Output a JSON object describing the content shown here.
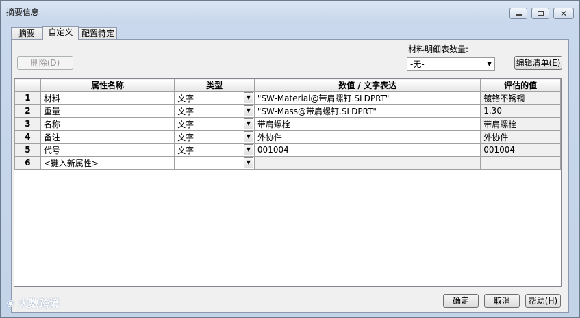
{
  "window": {
    "title": "摘要信息"
  },
  "tabs": [
    {
      "label": "摘要"
    },
    {
      "label": "自定义"
    },
    {
      "label": "配置特定"
    }
  ],
  "toolbar": {
    "delete_label": "删除(D)",
    "bom_label": "材料明细表数量:",
    "bom_value": "-无-",
    "edit_list_label": "编辑清单(E)"
  },
  "grid": {
    "columns": [
      "",
      "属性名称",
      "类型",
      "数值 / 文字表达",
      "评估的值"
    ],
    "rows": [
      {
        "num": "1",
        "name": "材料",
        "type": "文字",
        "expr": "\"SW-Material@带肩螺钉.SLDPRT\"",
        "value": "镀铬不锈钢"
      },
      {
        "num": "2",
        "name": "重量",
        "type": "文字",
        "expr": "\"SW-Mass@带肩螺钉.SLDPRT\"",
        "value": "1.30"
      },
      {
        "num": "3",
        "name": "名称",
        "type": "文字",
        "expr": "带肩螺栓",
        "value": "带肩螺栓"
      },
      {
        "num": "4",
        "name": "备注",
        "type": "文字",
        "expr": "外协件",
        "value": "外协件"
      },
      {
        "num": "5",
        "name": "代号",
        "type": "文字",
        "expr": "001004",
        "value": "001004"
      },
      {
        "num": "6",
        "name": "<键入新属性>",
        "type": "",
        "expr": "",
        "value": ""
      }
    ]
  },
  "footer": {
    "ok_label": "确定",
    "cancel_label": "取消",
    "help_label": "帮助(H)"
  },
  "watermark": {
    "text": "大数跨境"
  },
  "icons": {
    "minimize": "minimize-icon",
    "maximize": "maximize-icon",
    "close": "close-icon",
    "dropdown": "chevron-down-icon",
    "watermark_logo": "watermark-logo-icon"
  }
}
